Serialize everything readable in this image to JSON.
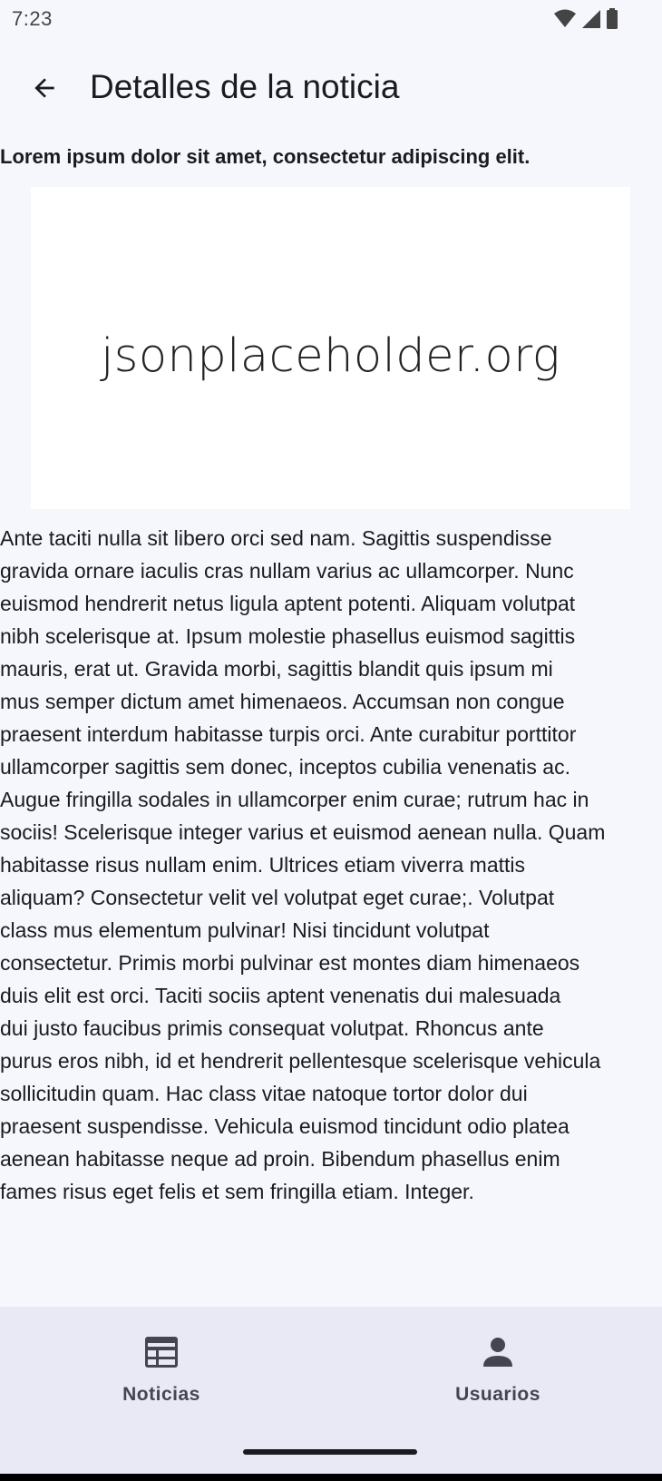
{
  "status_bar": {
    "time": "7:23"
  },
  "top_bar": {
    "title": "Detalles de la noticia"
  },
  "article": {
    "headline": "Lorem ipsum dolor sit amet, consectetur adipiscing elit.",
    "image_text": "jsonplaceholder.org",
    "body_lines": [
      "Ante taciti nulla sit libero orci sed nam. Sagittis suspendisse",
      "gravida ornare iaculis cras nullam varius ac ullamcorper. Nunc",
      "euismod hendrerit netus ligula aptent potenti. Aliquam volutpat",
      "nibh scelerisque at. Ipsum molestie phasellus euismod sagittis",
      "mauris, erat ut. Gravida morbi, sagittis blandit quis ipsum mi",
      "mus semper dictum amet himenaeos. Accumsan non congue",
      "praesent interdum habitasse turpis orci. Ante curabitur porttitor",
      "ullamcorper sagittis sem donec, inceptos cubilia venenatis ac.",
      "Augue fringilla sodales in ullamcorper enim curae; rutrum hac in",
      "sociis! Scelerisque integer varius et euismod aenean nulla. Quam",
      "habitasse risus nullam enim. Ultrices etiam viverra mattis",
      "aliquam? Consectetur velit vel volutpat eget curae;. Volutpat",
      "class mus elementum pulvinar! Nisi tincidunt volutpat",
      "consectetur. Primis morbi pulvinar est montes diam himenaeos",
      "duis elit est orci. Taciti sociis aptent venenatis dui malesuada",
      "dui justo faucibus primis consequat volutpat. Rhoncus ante",
      "purus eros nibh, id et hendrerit pellentesque scelerisque vehicula",
      "sollicitudin quam. Hac class vitae natoque tortor dolor dui",
      "praesent suspendisse. Vehicula euismod tincidunt odio platea",
      "aenean habitasse neque ad proin. Bibendum phasellus enim",
      "fames risus eget felis et sem fringilla etiam. Integer."
    ]
  },
  "bottom_nav": {
    "items": [
      {
        "label": "Noticias",
        "icon": "news-icon"
      },
      {
        "label": "Usuarios",
        "icon": "person-icon"
      }
    ]
  },
  "colors": {
    "background": "#f5f7fd",
    "nav_background": "#e8e9f4",
    "text": "#1b1b1f",
    "nav_label": "#44464f"
  }
}
